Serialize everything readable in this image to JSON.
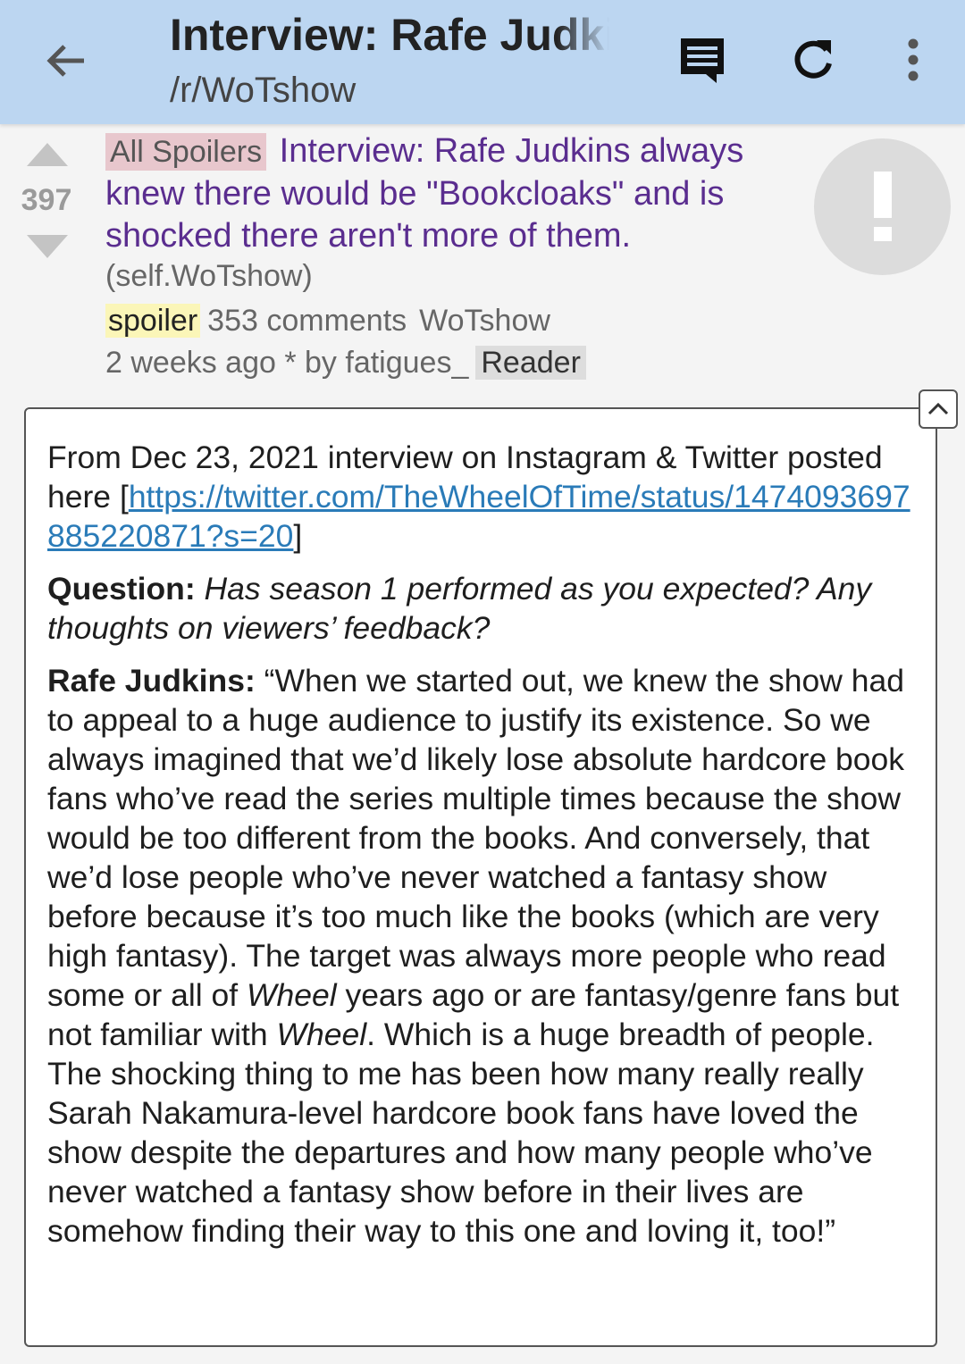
{
  "appbar": {
    "title": "Interview: Rafe Judkins always knew there would be \"Bookcloaks\" and is shocked there aren't more of them.",
    "subreddit": "/r/WoTshow",
    "icons": [
      "back-arrow-icon",
      "comments-icon",
      "refresh-icon",
      "more-vert-icon"
    ]
  },
  "post": {
    "score": "397",
    "flair": "All Spoilers",
    "title": "Interview: Rafe Judkins always knew there would be \"Bookcloaks\" and is shocked there aren't more of them.",
    "domain": "(self.WoTshow)",
    "spoiler_tag": "spoiler",
    "comments": "353 comments",
    "subreddit": "WoTshow",
    "age_author": "2 weeks ago * by fatigues_",
    "reader_tag": "Reader",
    "thumbnail_icon": "exclamation-icon"
  },
  "selftext": {
    "intro_line": "From Dec 23, 2021 interview on Instagram & Twitter posted here",
    "bracket_open": "[",
    "link": "https://twitter.com/TheWheelOfTime/status/1474093697885220871?s=20",
    "bracket_close": "]",
    "question_label": "Question:",
    "question_text": "Has season 1 performed as you expected? Any thoughts on viewers’ feedback?",
    "answer_label": "Rafe Judkins:",
    "answer_part1": "“When we started out, we knew the show had to appeal to a huge audience to justify its existence. So we always imagined that we’d likely lose absolute hardcore book fans who’ve read the series multiple times because the show would be too different from the books. And conversely, that we’d lose people who’ve never watched a fantasy show before because it’s too much like the books (which are very high fantasy). The target was always more people who read some or all of ",
    "answer_italic1": "Wheel",
    "answer_part2": " years ago or are fantasy/genre fans but not familiar with ",
    "answer_italic2": "Wheel",
    "answer_part3": ". Which is a huge breadth of people. The shocking thing to me has been how many really really Sarah Nakamura-level hardcore book fans have loved the show despite the departures and how many people who’ve never watched a fantasy show before in their lives are somehow finding their way to this one and loving it, too!”"
  },
  "colors": {
    "appbar_bg": "#bcd6f1",
    "title_purple": "#5a2d8f",
    "link_blue": "#2a7bb8",
    "flair_bg": "#e8c7cd",
    "spoiler_bg": "#fbf6b8"
  }
}
